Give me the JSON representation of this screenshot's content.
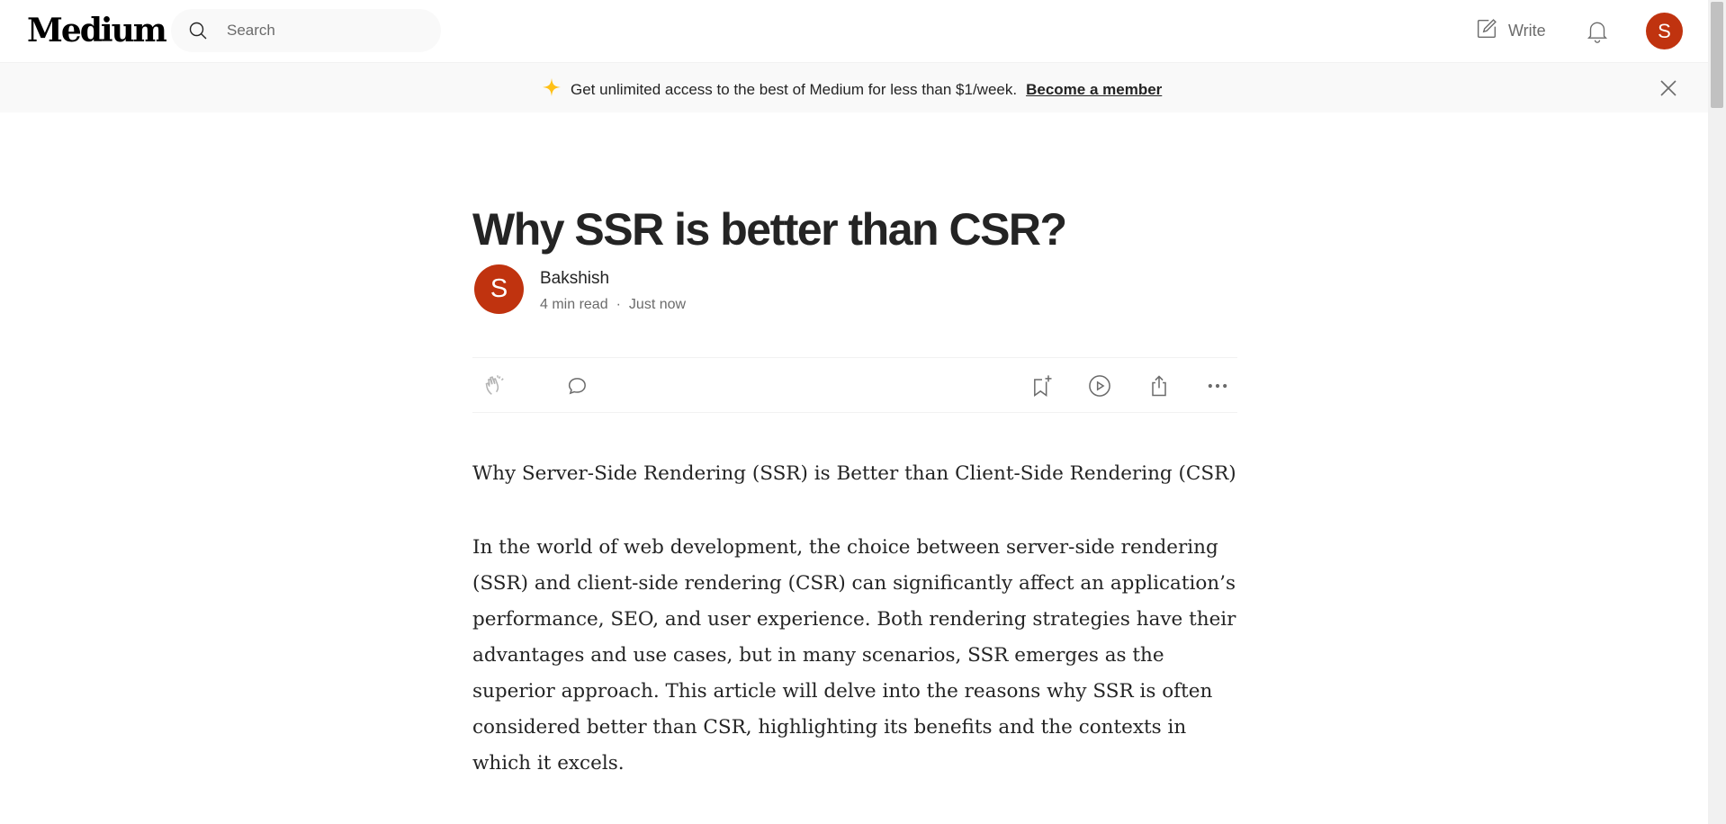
{
  "header": {
    "logo": "Medium",
    "search_placeholder": "Search",
    "write_label": "Write",
    "avatar_letter": "S"
  },
  "banner": {
    "text": "Get unlimited access to the best of Medium for less than $1/week.",
    "link": "Become a member"
  },
  "article": {
    "title": "Why SSR is better than CSR?",
    "author": {
      "name": "Bakshish",
      "avatar_letter": "S"
    },
    "read_time": "4 min read",
    "separator": "·",
    "published": "Just now",
    "paragraphs": [
      "Why Server-Side Rendering (SSR) is Better than Client-Side Rendering (CSR)",
      "In the world of web development, the choice between server-side rendering (SSR) and client-side rendering (CSR) can significantly affect an application’s performance, SEO, and user experience. Both rendering strategies have their advantages and use cases, but in many scenarios, SSR emerges as the superior approach. This article will delve into the reasons why SSR is often considered better than CSR, highlighting its benefits and the contexts in which it excels."
    ]
  },
  "icons": {
    "search": "search-icon",
    "write": "write-icon",
    "bell": "bell-icon",
    "sparkle": "sparkle-icon",
    "close": "close-icon",
    "clap": "clap-icon",
    "comment": "comment-icon",
    "bookmark": "bookmark-add-icon",
    "play": "play-icon",
    "share": "share-icon",
    "more": "more-icon"
  },
  "colors": {
    "avatar": "#c0330f",
    "sparkle": "#ffc017",
    "banner_bg": "#f9f9f9",
    "text": "#242424",
    "muted": "#6b6b6b"
  }
}
